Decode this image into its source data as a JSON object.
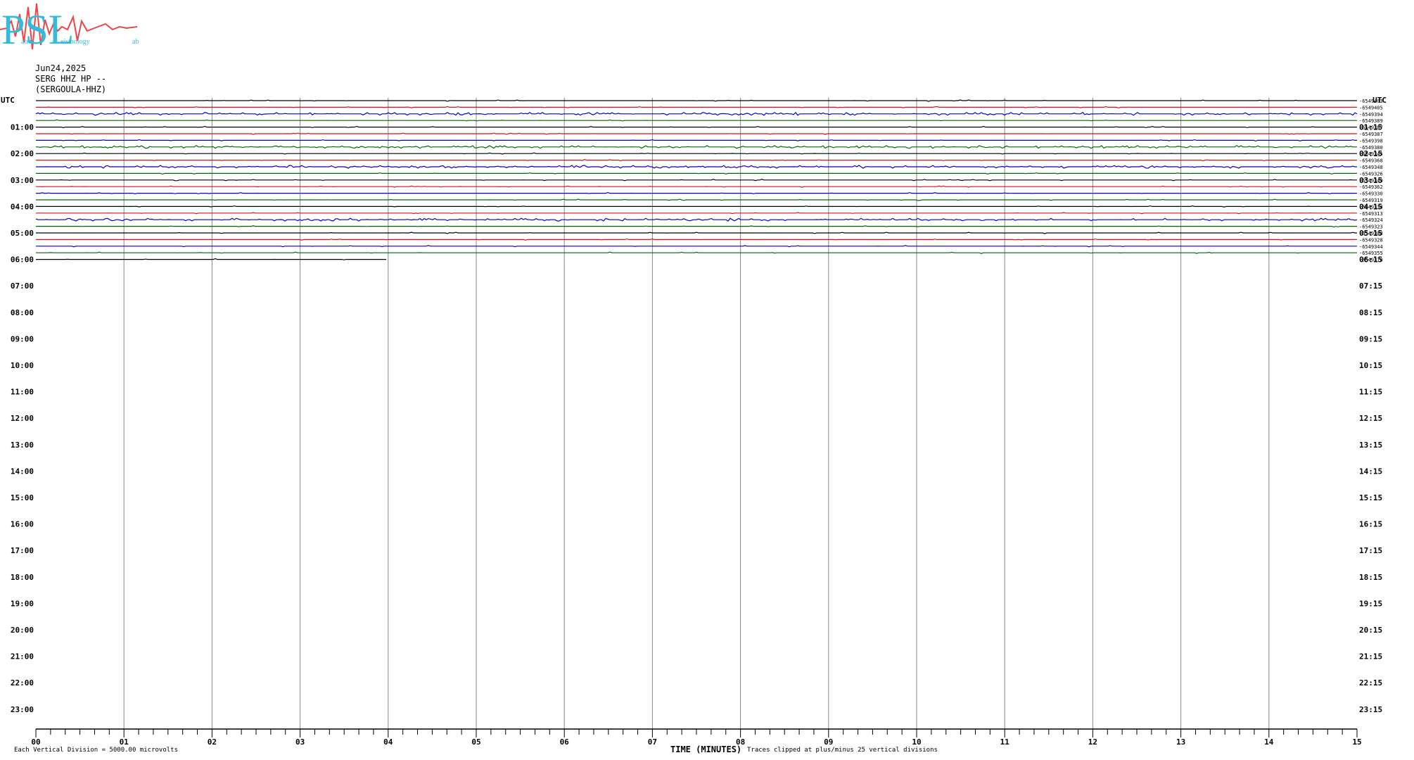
{
  "header": {
    "date": "Jun24,2025",
    "station": "SERG HHZ HP --",
    "name": "(SERGOULA-HHZ)"
  },
  "logo": {
    "text": "PSL",
    "sub1": "atras",
    "sub2": "eismology",
    "sub3": "ab"
  },
  "colors": {
    "black": "#000000",
    "red": "#dd1111",
    "blue": "#0000cc",
    "green": "#006600",
    "grid": "#888888",
    "logo_blue": "#33bbdd",
    "logo_red": "#ee4444"
  },
  "chart_data": {
    "type": "line",
    "title": "",
    "xlabel": "TIME (MINUTES)",
    "ylabel": "",
    "xlim": [
      0,
      15
    ],
    "x_ticks": [
      "00",
      "01",
      "02",
      "03",
      "04",
      "05",
      "06",
      "07",
      "08",
      "09",
      "10",
      "11",
      "12",
      "13",
      "14",
      "15"
    ],
    "left_axis_label": "UTC",
    "right_axis_label": "UTC",
    "left_hours": [
      "01:00",
      "02:00",
      "03:00",
      "04:00",
      "05:00",
      "06:00",
      "07:00",
      "08:00",
      "09:00",
      "10:00",
      "11:00",
      "12:00",
      "13:00",
      "14:00",
      "15:00",
      "16:00",
      "17:00",
      "18:00",
      "19:00",
      "20:00",
      "21:00",
      "22:00",
      "23:00"
    ],
    "right_hours": [
      "01:15",
      "02:15",
      "03:15",
      "04:15",
      "05:15",
      "06:15",
      "07:15",
      "08:15",
      "09:15",
      "10:15",
      "11:15",
      "12:15",
      "13:15",
      "14:15",
      "15:15",
      "16:15",
      "17:15",
      "18:15",
      "19:15",
      "20:15",
      "21:15",
      "22:15",
      "23:15"
    ],
    "trace_colors": [
      "black",
      "red",
      "blue",
      "green"
    ],
    "trace_offsets": [
      "-6549403",
      "-6549405",
      "-6549394",
      "-6549389",
      "-6549387",
      "-6549387",
      "-6549398",
      "-6549380",
      "-6549345",
      "-6549368",
      "-6549348",
      "-6549326",
      "-6549349",
      "-6549362",
      "-6549330",
      "-6549319",
      "-6549334",
      "-6549313",
      "-6549324",
      "-6549323",
      "-6549308",
      "-6549328",
      "-6549344",
      "-6549355",
      "-6549370"
    ],
    "final_trace_end_minutes": 4,
    "scale_note": "Each Vertical Division = 5000.00 microvolts",
    "clip_note": "Traces clipped at plus/minus 25 vertical divisions"
  }
}
